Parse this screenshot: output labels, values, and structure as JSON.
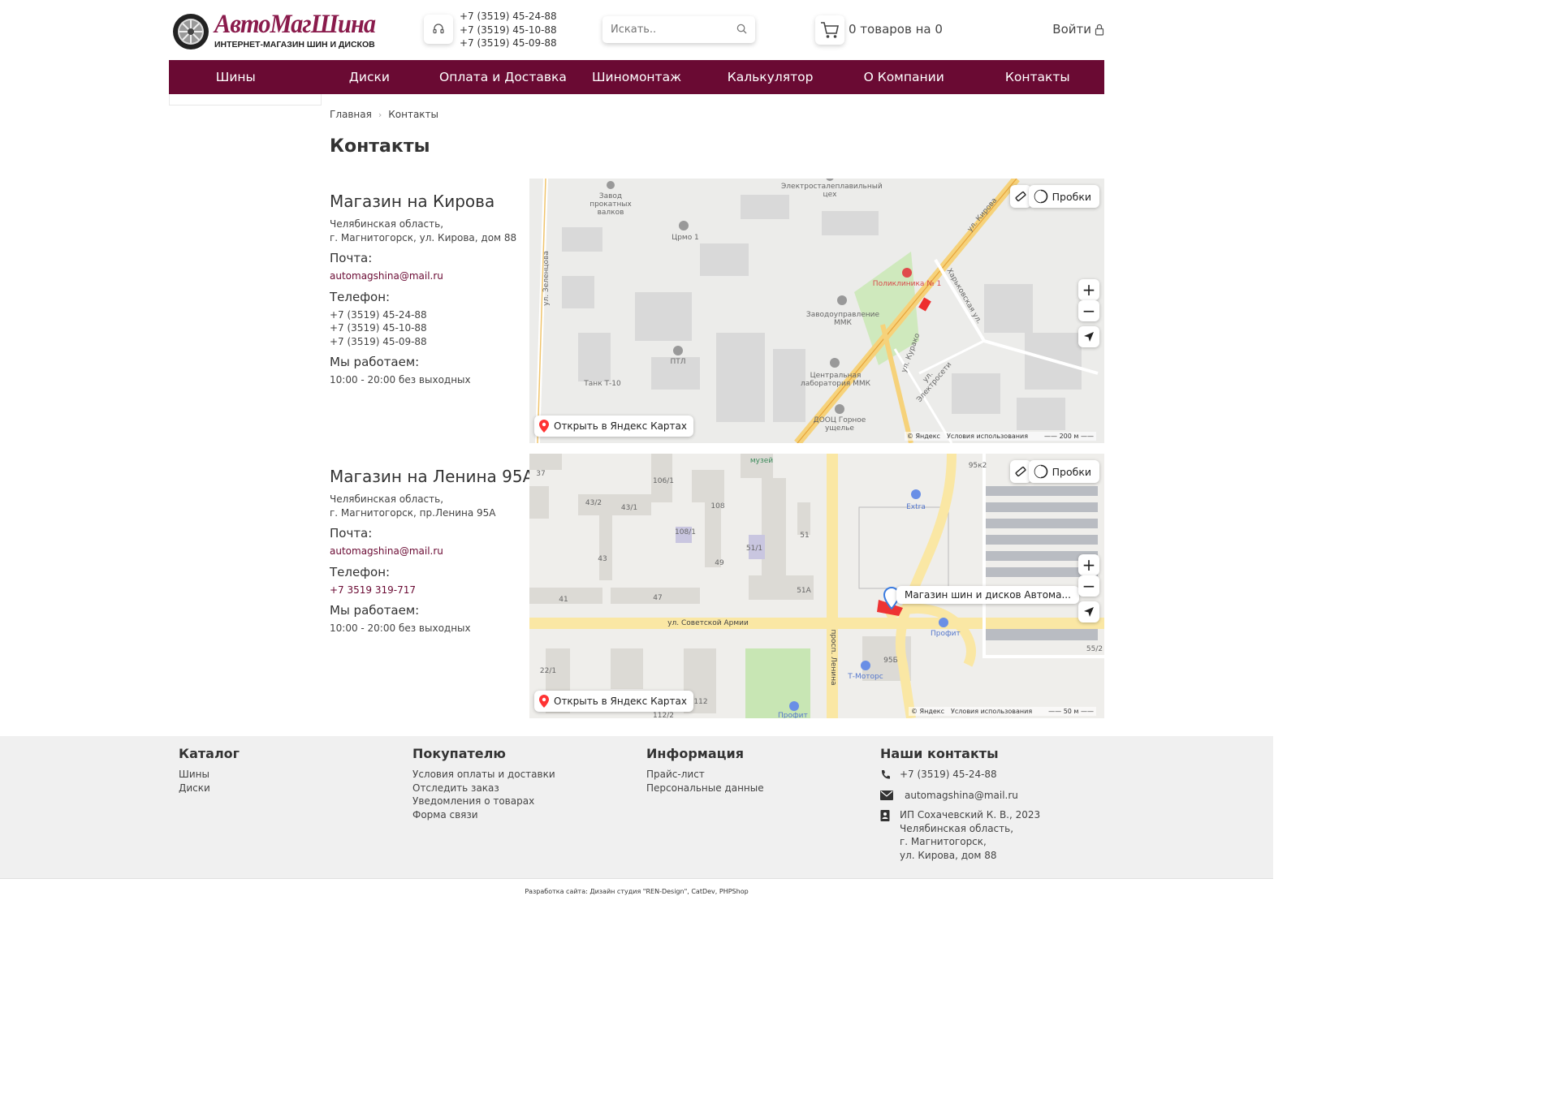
{
  "header": {
    "logo_name": "АвтоМагШина",
    "logo_tagline": "ИНТЕРНЕТ-МАГАЗИН ШИН И ДИСКОВ",
    "phones": [
      "+7 (3519) 45-24-88",
      "+7 (3519) 45-10-88",
      "+7 (3519) 45-09-88"
    ],
    "search_placeholder": "Искать..",
    "cart_text": "0 товаров на 0",
    "login_label": "Войти"
  },
  "nav": [
    "Шины",
    "Диски",
    "Оплата и Доставка",
    "Шиномонтаж",
    "Калькулятор",
    "О Компании",
    "Контакты"
  ],
  "breadcrumb": [
    "Главная",
    "Контакты"
  ],
  "page_title": "Контакты",
  "stores": [
    {
      "title": "Магазин на Кирова",
      "address": [
        "Челябинская область,",
        "г. Магнитогорск, ул. Кирова, дом 88"
      ],
      "email_label": "Почта:",
      "email": "automagshina@mail.ru",
      "phone_label": "Телефон:",
      "phones": [
        "+7 (3519) 45-24-88",
        "+7 (3519) 45-10-88",
        "+7 (3519) 45-09-88"
      ],
      "hours_label": "Мы работаем:",
      "hours": "10:00 - 20:00 без выходных"
    },
    {
      "title": "Магазин на Ленина 95А",
      "address": [
        "Челябинская область,",
        "г. Магнитогорск, пр.Ленина 95А"
      ],
      "email_label": "Почта:",
      "email": "automagshina@mail.ru",
      "phone_label": "Телефон:",
      "phone_link": "+7 3519 319-717",
      "hours_label": "Мы работаем:",
      "hours": "10:00 - 20:00 без выходных"
    }
  ],
  "map": {
    "open_label": "Открыть в Яндекс Картах",
    "traffic_label": "Пробки",
    "yandex_label": "© Яндекс",
    "terms_label": "Условия использования",
    "map1": {
      "scale": "200 м",
      "labels": [
        "Завод прокатных валков",
        "Электростaлеплавильный цех",
        "Црмо 1",
        "Поликлиника № 1",
        "Заводоуправление ММК",
        "ПТЛ",
        "Танк Т-10",
        "Центральная лаборатория ММК",
        "ДООЦ Горное ущелье",
        "ул. Кирова",
        "ул. Зеленцова",
        "Харьковская ул.",
        "ул. Курако",
        "ул. Электросети"
      ]
    },
    "map2": {
      "scale": "50 м",
      "marker_label": "Магазин шин и дисков Автома...",
      "labels": [
        "музей",
        "Extra",
        "ул. Советской Армии",
        "просп. Ленина",
        "Профит",
        "Т-Моторс",
        "95Б",
        "Профит",
        "37",
        "106/1",
        "43/2",
        "43/1",
        "108",
        "108/1",
        "51",
        "51/1",
        "43",
        "49",
        "51А",
        "41",
        "47",
        "22/1",
        "112",
        "112/2",
        "95к2",
        "55/2"
      ]
    }
  },
  "footer": {
    "catalog_title": "Каталог",
    "catalog_links": [
      "Шины",
      "Диски"
    ],
    "buyer_title": "Покупателю",
    "buyer_links": [
      "Условия оплаты и доставки",
      "Отследить заказ",
      "Уведомления о товарах",
      "Форма связи"
    ],
    "info_title": "Информация",
    "info_links": [
      "Прайс-лист",
      "Персональные данные"
    ],
    "contacts_title": "Наши контакты",
    "contact_phone": "+7 (3519) 45-24-88",
    "contact_email": "automagshina@mail.ru",
    "contact_company": [
      "ИП Сохачевский К. В., 2023",
      "Челябинская область,",
      "г. Магнитогорск,",
      "ул. Кирова, дом 88"
    ]
  },
  "credits": "Разработка сайта: Дизайн студия \"REN-Design\", CatDev, PHPShop",
  "colors": {
    "brand": "#6a0a33",
    "logo": "#8a1b4c",
    "footer_bg": "#f0f0f0"
  }
}
